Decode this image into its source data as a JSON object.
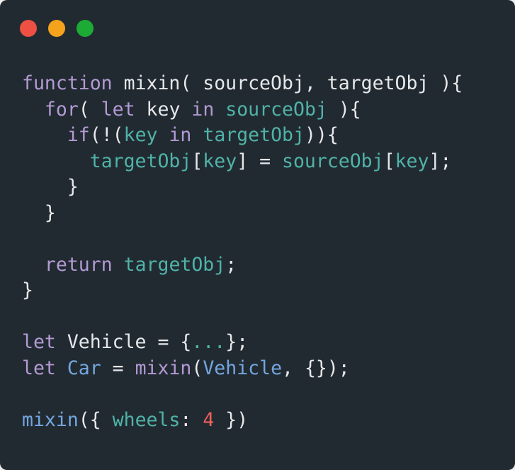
{
  "window": {
    "controls": [
      {
        "name": "close",
        "color": "#ee5144"
      },
      {
        "name": "minimize",
        "color": "#f5a31c"
      },
      {
        "name": "maximize",
        "color": "#1cac35"
      }
    ]
  },
  "colors": {
    "background": "#222a31",
    "keyword": "#b39ad4",
    "identifier": "#e6e8ea",
    "variable": "#4fb3a8",
    "class": "#73a7df",
    "number": "#f0625a",
    "punctuation": "#e6e8ea"
  },
  "code": {
    "lines": [
      {
        "tokens": [
          {
            "t": "function",
            "c": "keyword"
          },
          {
            "t": " mixin( sourceObj, targetObj ){",
            "c": "identifier"
          }
        ]
      },
      {
        "tokens": [
          {
            "t": "  ",
            "c": "identifier"
          },
          {
            "t": "for",
            "c": "keyword"
          },
          {
            "t": "( ",
            "c": "identifier"
          },
          {
            "t": "let",
            "c": "keyword"
          },
          {
            "t": " key ",
            "c": "identifier"
          },
          {
            "t": "in",
            "c": "keyword"
          },
          {
            "t": " ",
            "c": "identifier"
          },
          {
            "t": "sourceObj",
            "c": "variable"
          },
          {
            "t": " ){",
            "c": "identifier"
          }
        ]
      },
      {
        "tokens": [
          {
            "t": "    ",
            "c": "identifier"
          },
          {
            "t": "if",
            "c": "keyword"
          },
          {
            "t": "(!(",
            "c": "identifier"
          },
          {
            "t": "key",
            "c": "variable"
          },
          {
            "t": " ",
            "c": "identifier"
          },
          {
            "t": "in",
            "c": "keyword"
          },
          {
            "t": " ",
            "c": "identifier"
          },
          {
            "t": "targetObj",
            "c": "variable"
          },
          {
            "t": ")){",
            "c": "identifier"
          }
        ]
      },
      {
        "tokens": [
          {
            "t": "      ",
            "c": "identifier"
          },
          {
            "t": "targetObj",
            "c": "variable"
          },
          {
            "t": "[",
            "c": "identifier"
          },
          {
            "t": "key",
            "c": "variable"
          },
          {
            "t": "] = ",
            "c": "identifier"
          },
          {
            "t": "sourceObj",
            "c": "variable"
          },
          {
            "t": "[",
            "c": "identifier"
          },
          {
            "t": "key",
            "c": "variable"
          },
          {
            "t": "];",
            "c": "identifier"
          }
        ]
      },
      {
        "tokens": [
          {
            "t": "    }",
            "c": "identifier"
          }
        ]
      },
      {
        "tokens": [
          {
            "t": "  }",
            "c": "identifier"
          }
        ]
      },
      {
        "blank": true
      },
      {
        "tokens": [
          {
            "t": "  ",
            "c": "identifier"
          },
          {
            "t": "return",
            "c": "keyword"
          },
          {
            "t": " ",
            "c": "identifier"
          },
          {
            "t": "targetObj",
            "c": "variable"
          },
          {
            "t": ";",
            "c": "identifier"
          }
        ]
      },
      {
        "tokens": [
          {
            "t": "}",
            "c": "identifier"
          }
        ]
      },
      {
        "blank": true
      },
      {
        "tokens": [
          {
            "t": "let",
            "c": "keyword"
          },
          {
            "t": " Vehicle = {",
            "c": "identifier"
          },
          {
            "t": "...",
            "c": "variable"
          },
          {
            "t": "};",
            "c": "identifier"
          }
        ]
      },
      {
        "tokens": [
          {
            "t": "let",
            "c": "keyword"
          },
          {
            "t": " ",
            "c": "identifier"
          },
          {
            "t": "Car",
            "c": "class"
          },
          {
            "t": " = ",
            "c": "identifier"
          },
          {
            "t": "mixin",
            "c": "keyword"
          },
          {
            "t": "(",
            "c": "identifier"
          },
          {
            "t": "Vehicle",
            "c": "class"
          },
          {
            "t": ", {});",
            "c": "identifier"
          }
        ]
      },
      {
        "blank": true
      },
      {
        "tokens": [
          {
            "t": "mixin",
            "c": "class"
          },
          {
            "t": "({ ",
            "c": "identifier"
          },
          {
            "t": "wheels",
            "c": "variable"
          },
          {
            "t": ": ",
            "c": "identifier"
          },
          {
            "t": "4",
            "c": "number"
          },
          {
            "t": " })",
            "c": "identifier"
          }
        ]
      }
    ]
  }
}
